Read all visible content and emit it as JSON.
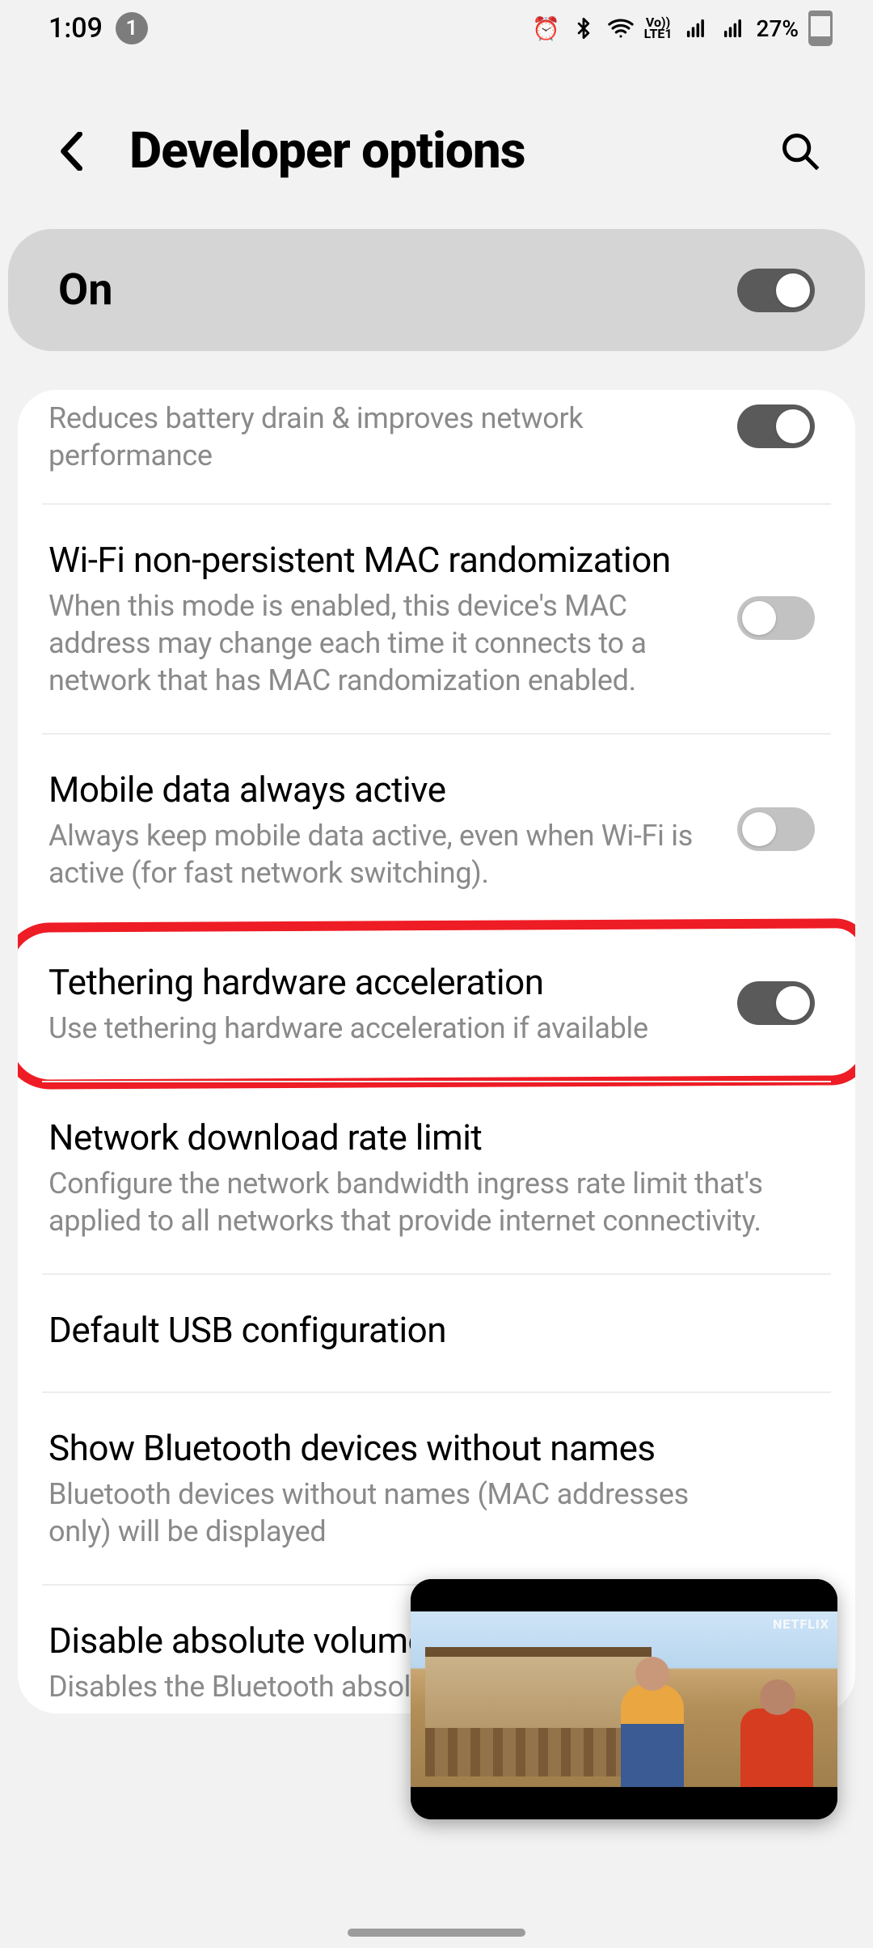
{
  "status": {
    "time": "1:09",
    "notif_count": "1",
    "lte_label": "Vo))\nLTE1",
    "battery_pct": "27%"
  },
  "header": {
    "title": "Developer options"
  },
  "master": {
    "label": "On",
    "state": "on"
  },
  "items": [
    {
      "title": "",
      "desc": "Reduces battery drain & improves network performance",
      "toggle": "on"
    },
    {
      "title": "Wi-Fi non-persistent MAC randomization",
      "desc": "When this mode is enabled, this device's MAC address may change each time it connects to a network that has MAC randomization enabled.",
      "toggle": "off"
    },
    {
      "title": "Mobile data always active",
      "desc": "Always keep mobile data active, even when Wi-Fi is active (for fast network switching).",
      "toggle": "off"
    },
    {
      "title": "Tethering hardware acceleration",
      "desc": "Use tethering hardware acceleration if available",
      "toggle": "on",
      "highlighted": true
    },
    {
      "title": "Network download rate limit",
      "desc": "Configure the network bandwidth ingress rate limit that's applied to all networks that provide internet connectivity.",
      "toggle": null
    },
    {
      "title": "Default USB configuration",
      "desc": "",
      "toggle": null
    },
    {
      "title": "Show Bluetooth devices without names",
      "desc": "Bluetooth devices without names (MAC addresses only) will be displayed",
      "toggle": "off"
    },
    {
      "title": "Disable absolute volume",
      "desc": "Disables the Bluetooth absolute volume feature",
      "toggle": "off"
    }
  ],
  "pip": {
    "badge": "NETFLIX"
  }
}
